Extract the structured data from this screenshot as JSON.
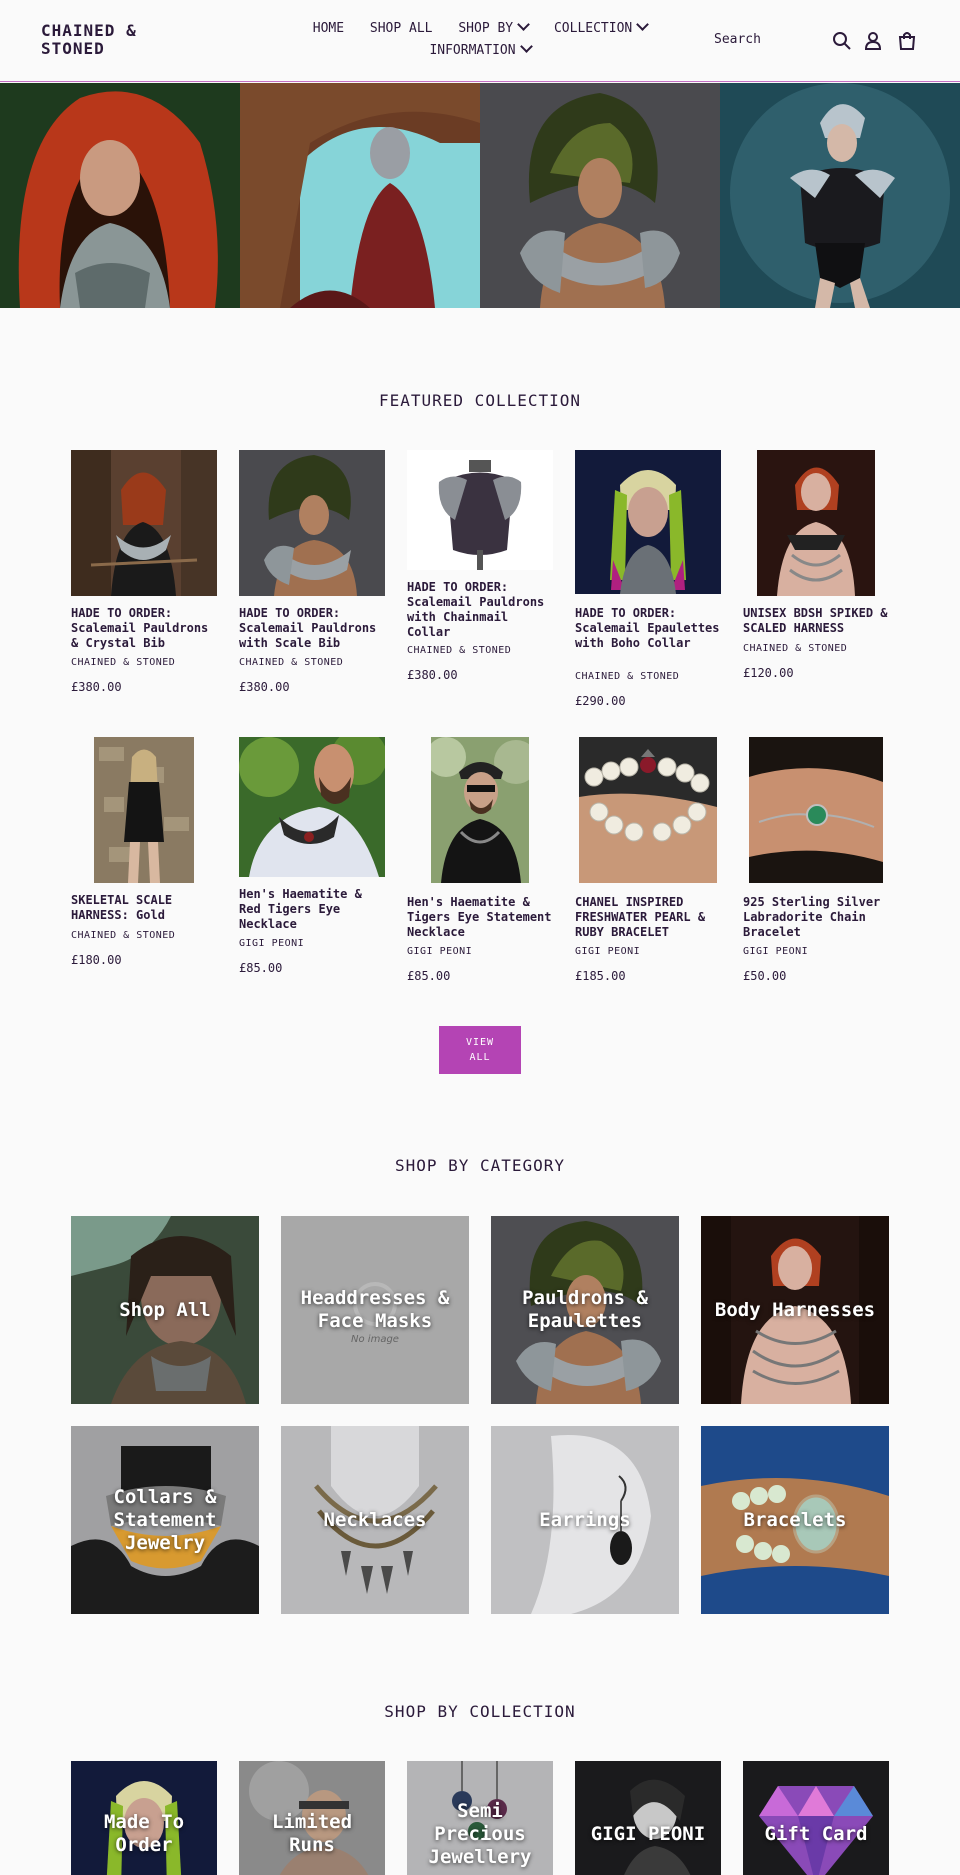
{
  "header": {
    "logo": "CHAINED & STONED",
    "nav": [
      {
        "label": "HOME"
      },
      {
        "label": "SHOP ALL"
      },
      {
        "label": "SHOP BY"
      },
      {
        "label": "COLLECTION"
      },
      {
        "label": "INFORMATION"
      }
    ],
    "search_label": "Search"
  },
  "hero": {
    "images": [
      "hero-red-hood",
      "hero-masked-woman",
      "hero-feather-headdress",
      "hero-silver-armor"
    ]
  },
  "featured": {
    "title": "FEATURED COLLECTION",
    "products": [
      {
        "title": "HADE TO ORDER: Scalemail Pauldrons & Crystal Bib",
        "vendor": "CHAINED & STONED",
        "price": "£380.00"
      },
      {
        "title": "HADE TO ORDER: Scalemail Pauldrons with Scale Bib",
        "vendor": "CHAINED & STONED",
        "price": "£380.00"
      },
      {
        "title": "HADE TO ORDER: Scalemail Pauldrons with Chainmail Collar",
        "vendor": "CHAINED & STONED",
        "price": "£380.00"
      },
      {
        "title": "HADE TO ORDER: Scalemail Epaulettes with Boho Collar",
        "vendor": "CHAINED & STONED",
        "price": "£290.00"
      },
      {
        "title": "UNISEX BDSH SPIKED & SCALED HARNESS",
        "vendor": "CHAINED & STONED",
        "price": "£120.00"
      },
      {
        "title": "SKELETAL SCALE HARNESS: Gold",
        "vendor": "CHAINED & STONED",
        "price": "£180.00"
      },
      {
        "title": "Hen's Haematite & Red Tigers Eye Necklace",
        "vendor": "GIGI PEONI",
        "price": "£85.00"
      },
      {
        "title": "Hen's Haematite & Tigers Eye Statement Necklace",
        "vendor": "GIGI PEONI",
        "price": "£85.00"
      },
      {
        "title": "CHANEL INSPIRED FRESHWATER PEARL & RUBY BRACELET",
        "vendor": "GIGI PEONI",
        "price": "£185.00"
      },
      {
        "title": "925 Sterling Silver Labradorite Chain Bracelet",
        "vendor": "GIGI PEONI",
        "price": "£50.00"
      }
    ],
    "view_all": "VIEW ALL"
  },
  "categories": {
    "title": "SHOP BY CATEGORY",
    "items": [
      {
        "label": "Shop All"
      },
      {
        "label": "Headdresses & Face Masks",
        "placeholder": "No image"
      },
      {
        "label": "Pauldrons & Epaulettes"
      },
      {
        "label": "Body Harnesses"
      },
      {
        "label": "Collars & Statement Jewelry"
      },
      {
        "label": "Necklaces"
      },
      {
        "label": "Earrings"
      },
      {
        "label": "Bracelets"
      }
    ]
  },
  "collections": {
    "title": "SHOP BY COLLECTION",
    "items": [
      {
        "label": "Made To Order"
      },
      {
        "label": "Limited Runs"
      },
      {
        "label": "Semi Precious Jewellery"
      },
      {
        "label": "GIGI PEONI"
      },
      {
        "label": "Gift Card"
      }
    ]
  },
  "colors": {
    "accent": "#b444b4",
    "text": "#2b1a3a",
    "background": "#fafafa"
  }
}
